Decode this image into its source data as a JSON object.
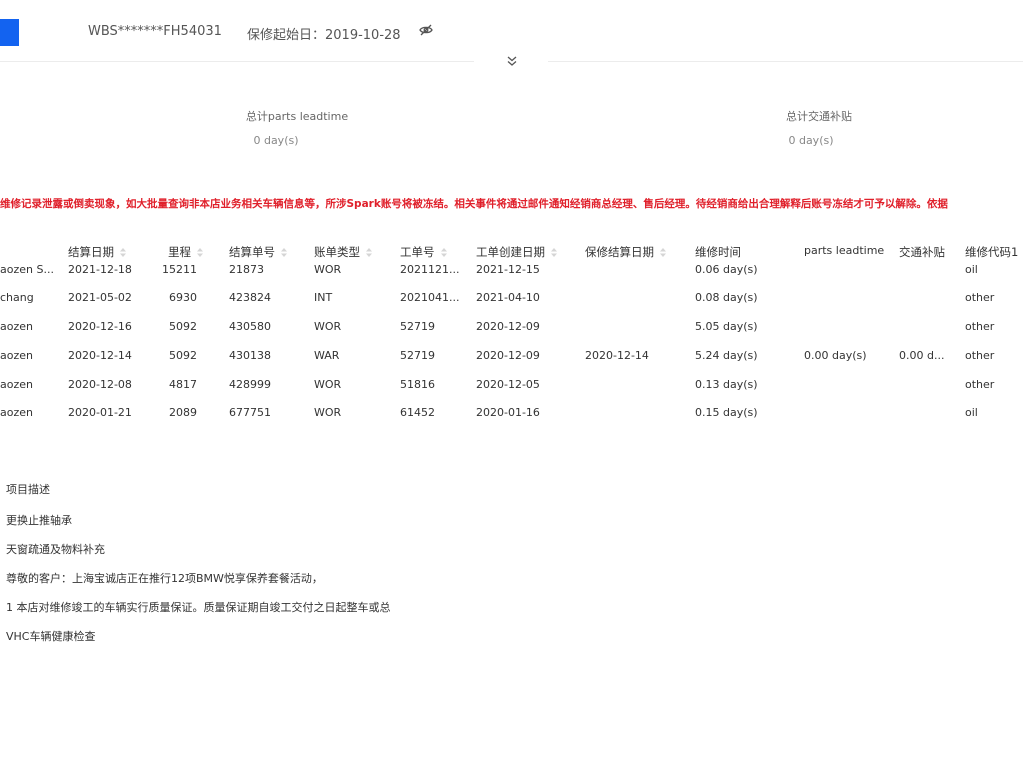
{
  "header": {
    "vin": "WBS*******FH54031",
    "warranty_start": "保修起始日：2019-10-28",
    "visibility_icon": "eye-slash-icon",
    "expand_icon": "double-chevron-down-icon"
  },
  "stats": [
    {
      "title": "总计parts leadtime",
      "value": "0 day(s)"
    },
    {
      "title": "总计交通补贴",
      "value": "0 day(s)"
    }
  ],
  "warning": "维修记录泄露或倒卖现象，如大批量查询非本店业务相关车辆信息等，所涉Spark账号将被冻结。相关事件将通过邮件通知经销商总经理、售后经理。待经销商给出合理解释后账号冻结才可予以解除。依据",
  "table": {
    "columns": [
      "结算日期",
      "里程",
      "结算单号",
      "账单类型",
      "工单号",
      "工单创建日期",
      "保修结算日期",
      "维修时间",
      "parts leadtime",
      "交通补贴",
      "维修代码1"
    ],
    "rows": [
      [
        "aozen S...",
        "2021-12-18",
        "15211",
        "21873",
        "WOR",
        "2021121...",
        "2021-12-15",
        "",
        "0.06 day(s)",
        "",
        "",
        "oil"
      ],
      [
        "chang",
        "2021-05-02",
        "6930",
        "423824",
        "INT",
        "2021041...",
        "2021-04-10",
        "",
        "0.08 day(s)",
        "",
        "",
        "other"
      ],
      [
        "aozen",
        "2020-12-16",
        "5092",
        "430580",
        "WOR",
        "52719",
        "2020-12-09",
        "",
        "5.05 day(s)",
        "",
        "",
        "other"
      ],
      [
        "aozen",
        "2020-12-14",
        "5092",
        "430138",
        "WAR",
        "52719",
        "2020-12-09",
        "2020-12-14",
        "5.24 day(s)",
        "0.00 day(s)",
        "0.00 d...",
        "other"
      ],
      [
        "aozen",
        "2020-12-08",
        "4817",
        "428999",
        "WOR",
        "51816",
        "2020-12-05",
        "",
        "0.13 day(s)",
        "",
        "",
        "other"
      ],
      [
        "aozen",
        "2020-01-21",
        "2089",
        "677751",
        "WOR",
        "61452",
        "2020-01-16",
        "",
        "0.15 day(s)",
        "",
        "",
        "oil"
      ]
    ]
  },
  "descriptions": {
    "header": "项目描述",
    "items": [
      "更换止推轴承",
      "天窗疏通及物料补充",
      "尊敬的客户：上海宝诚店正在推行12项BMW悦享保养套餐活动，",
      "1 本店对维修竣工的车辆实行质量保证。质量保证期自竣工交付之日起整车或总",
      "VHC车辆健康检查"
    ]
  }
}
